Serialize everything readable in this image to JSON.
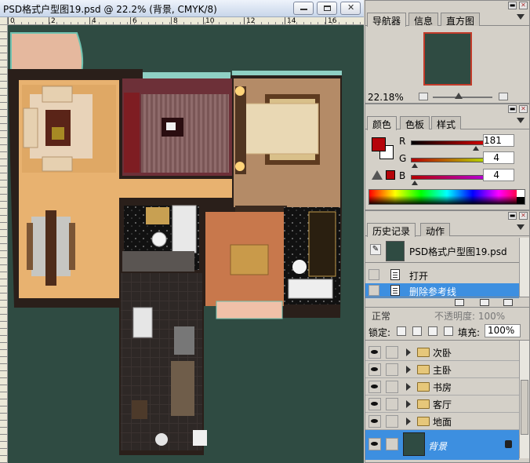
{
  "document": {
    "title": "PSD格式户型图19.psd @ 22.2% (背景, CMYK/8)",
    "ruler_ticks": [
      "0",
      "2",
      "4",
      "6",
      "8",
      "10",
      "12",
      "14",
      "16"
    ]
  },
  "navigator": {
    "tabs": [
      "导航器",
      "信息",
      "直方图"
    ],
    "zoom": "22.18%"
  },
  "color": {
    "tabs": [
      "颜色",
      "色板",
      "样式"
    ],
    "foreground": "#b5040a",
    "background": "#ffffff",
    "channels": [
      {
        "label": "R",
        "value": "181"
      },
      {
        "label": "G",
        "value": "4"
      },
      {
        "label": "B",
        "value": "4"
      }
    ]
  },
  "history": {
    "tabs": [
      "历史记录",
      "动作"
    ],
    "snapshot": "PSD格式户型图19.psd",
    "states": [
      {
        "label": "打开",
        "selected": false
      },
      {
        "label": "删除参考线",
        "selected": true
      }
    ]
  },
  "layers": {
    "blend_mode": "正常",
    "opacity_label": "不透明度: 100%",
    "lock_label": "锁定:",
    "fill_label": "填充:",
    "fill_value": "100%",
    "groups": [
      "次卧",
      "主卧",
      "书房",
      "客厅",
      "地面"
    ],
    "background_layer": "背景"
  }
}
